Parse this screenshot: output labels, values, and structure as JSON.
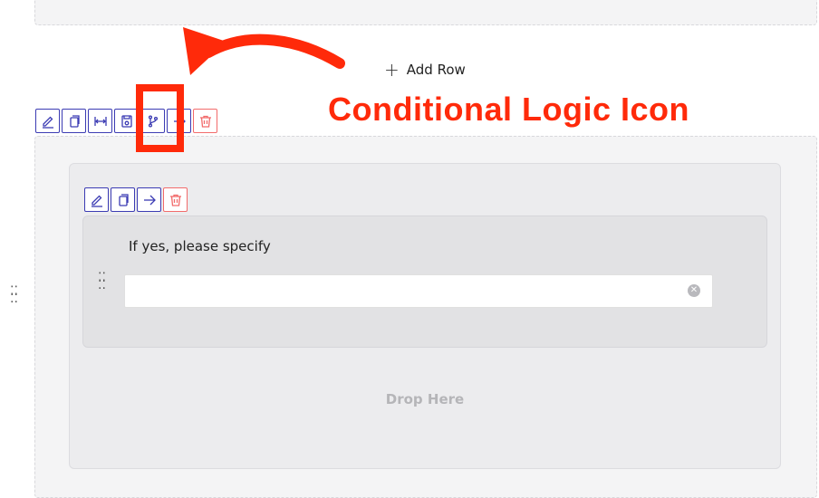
{
  "add_row": {
    "label": "Add Row"
  },
  "row_toolbar": {
    "buttons": [
      "edit-icon",
      "copy-icon",
      "width-icon",
      "save-icon",
      "conditional-logic-icon",
      "move-icon",
      "trash-icon"
    ]
  },
  "column_toolbar": {
    "buttons": [
      "edit-icon",
      "copy-icon",
      "move-icon",
      "trash-icon"
    ]
  },
  "field": {
    "label": "If yes, please specify",
    "value": "",
    "clear_icon": "clear-icon"
  },
  "drop_zone": {
    "label": "Drop Here"
  },
  "annotation": {
    "text": "Conditional Logic Icon",
    "color": "#ff2a0a"
  },
  "colors": {
    "toolbar_border": "#3b3bb3",
    "delete_border": "#f26b6b"
  }
}
